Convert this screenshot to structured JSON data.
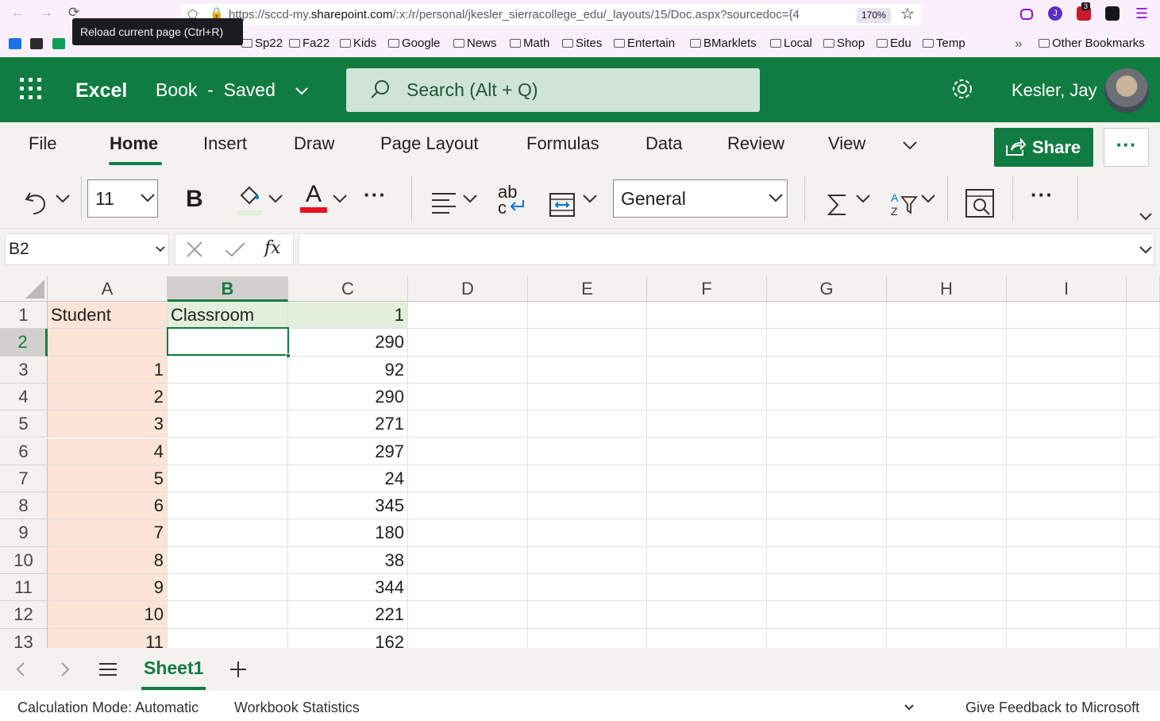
{
  "browser": {
    "url_prefix": "https://sccd-my.",
    "url_domain": "sharepoint.com",
    "url_suffix": "/:x:/r/personal/jkesler_sierracollege_edu/_layouts/15/Doc.aspx?sourcedoc={4",
    "zoom": "170%",
    "tooltip": "Reload current page (Ctrl+R)",
    "badge_count": "3",
    "profile_letter": "J",
    "bookmarks": [
      "Sp22",
      "Fa22",
      "Kids",
      "Google",
      "News",
      "Math",
      "Sites",
      "Entertain",
      "BMarklets",
      "Local",
      "Shop",
      "Edu",
      "Temp"
    ],
    "other_bookmarks": "Other Bookmarks"
  },
  "app": {
    "name": "Excel",
    "doc_name": "Book",
    "doc_sep": "-",
    "doc_status": "Saved",
    "search_placeholder": "Search (Alt + Q)",
    "user_name": "Kesler, Jay"
  },
  "ribbon": {
    "tabs": [
      "File",
      "Home",
      "Insert",
      "Draw",
      "Page Layout",
      "Formulas",
      "Data",
      "Review",
      "View"
    ],
    "active_tab": "Home",
    "share_label": "Share",
    "more_label": "···",
    "font_size": "11",
    "bold_label": "B",
    "font_color_label": "A",
    "number_format": "General",
    "wrap_label_top": "ab",
    "wrap_label_bottom": "c",
    "ellipsis": "···",
    "fill_color": "#e2efda",
    "font_color": "#e81123"
  },
  "formula_bar": {
    "name_box": "B2",
    "fx_label": "fx",
    "formula": ""
  },
  "grid": {
    "columns": [
      "A",
      "B",
      "C",
      "D",
      "E",
      "F",
      "G",
      "H",
      "I"
    ],
    "selected_column": "B",
    "selected_row": "2",
    "rows": [
      {
        "n": "1",
        "a": "Student",
        "b": "Classroom",
        "c": "1"
      },
      {
        "n": "2",
        "a": "",
        "b": "",
        "c": "290"
      },
      {
        "n": "3",
        "a": "1",
        "b": "",
        "c": "92"
      },
      {
        "n": "4",
        "a": "2",
        "b": "",
        "c": "290"
      },
      {
        "n": "5",
        "a": "3",
        "b": "",
        "c": "271"
      },
      {
        "n": "6",
        "a": "4",
        "b": "",
        "c": "297"
      },
      {
        "n": "7",
        "a": "5",
        "b": "",
        "c": "24"
      },
      {
        "n": "8",
        "a": "6",
        "b": "",
        "c": "345"
      },
      {
        "n": "9",
        "a": "7",
        "b": "",
        "c": "180"
      },
      {
        "n": "10",
        "a": "8",
        "b": "",
        "c": "38"
      },
      {
        "n": "11",
        "a": "9",
        "b": "",
        "c": "344"
      },
      {
        "n": "12",
        "a": "10",
        "b": "",
        "c": "221"
      },
      {
        "n": "13",
        "a": "11",
        "b": "",
        "c": "162"
      }
    ],
    "col_a_fill": "#fce4d6",
    "header_row_fill": "#e2efda"
  },
  "sheets": {
    "active": "Sheet1"
  },
  "status": {
    "calc_mode": "Calculation Mode: Automatic",
    "workbook_stats": "Workbook Statistics",
    "feedback": "Give Feedback to Microsoft"
  }
}
